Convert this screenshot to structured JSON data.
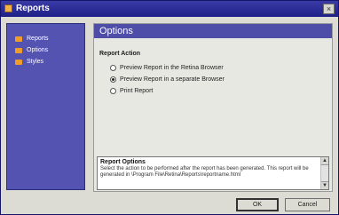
{
  "window": {
    "title": "Reports",
    "close_glyph": "×",
    "icon": "app-icon"
  },
  "sidebar": {
    "items": [
      {
        "label": "Reports"
      },
      {
        "label": "Options"
      },
      {
        "label": "Styles"
      }
    ]
  },
  "main": {
    "header": "Options",
    "section_title": "Report Action",
    "radio_options": [
      {
        "label": "Preview Report in the Retina Browser",
        "checked": false
      },
      {
        "label": "Preview Report in a separate Browser",
        "checked": true
      },
      {
        "label": "Print Report",
        "checked": false
      }
    ]
  },
  "options_box": {
    "title": "Report Options",
    "text": "Select the action to be performed after the report has been generated. This report will be generated in \\Program File\\Retina\\Reports\\reportname.html"
  },
  "scrollbar": {
    "up": "▲",
    "down": "▼"
  },
  "buttons": {
    "ok": "OK",
    "cancel": "Cancel"
  }
}
